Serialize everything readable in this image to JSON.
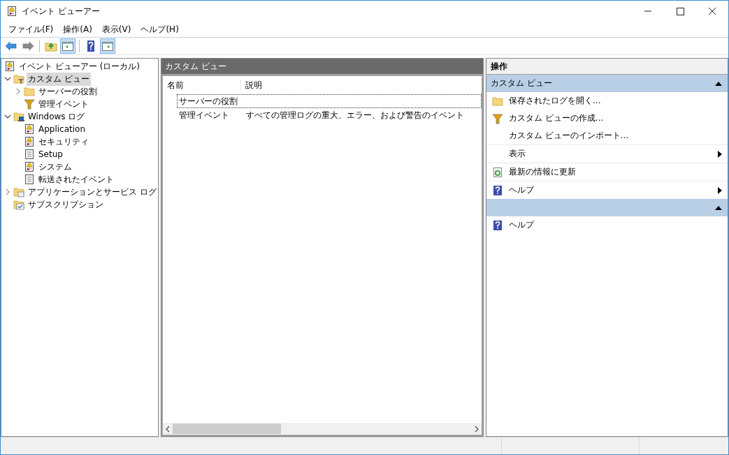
{
  "window": {
    "title": "イベント ビューアー"
  },
  "menu": [
    "ファイル(F)",
    "操作(A)",
    "表示(V)",
    "ヘルプ(H)"
  ],
  "toolbar": [
    [
      {
        "kind": "back",
        "on": false
      },
      {
        "kind": "forward",
        "on": false
      }
    ],
    [
      {
        "kind": "up",
        "on": false
      },
      {
        "kind": "tree",
        "on": true
      }
    ],
    [
      {
        "kind": "help",
        "on": false
      },
      {
        "kind": "pane",
        "on": true
      }
    ]
  ],
  "tree": {
    "items": [
      {
        "label": "イベント ビューアー (ローカル)",
        "kind": "viewer",
        "selected": false,
        "children": [
          {
            "label": "カスタム ビュー",
            "kind": "filterfolder",
            "selected": true,
            "expanded": true,
            "children": [
              {
                "label": "サーバーの役割",
                "kind": "folder",
                "selected": false,
                "expanded": false
              },
              {
                "label": "管理イベント",
                "kind": "filter",
                "selected": false
              }
            ]
          },
          {
            "label": "Windows ログ",
            "kind": "winfolder",
            "selected": false,
            "expanded": true,
            "children": [
              {
                "label": "Application",
                "kind": "warnlog",
                "selected": false
              },
              {
                "label": "セキュリティ",
                "kind": "warnlog",
                "selected": false
              },
              {
                "label": "Setup",
                "kind": "log",
                "selected": false
              },
              {
                "label": "システム",
                "kind": "warnlog",
                "selected": false
              },
              {
                "label": "転送されたイベント",
                "kind": "log",
                "selected": false
              }
            ]
          },
          {
            "label": "アプリケーションとサービス ログ",
            "kind": "appfolder",
            "selected": false,
            "expanded": false
          },
          {
            "label": "サブスクリプション",
            "kind": "subs",
            "selected": false
          }
        ]
      }
    ]
  },
  "center": {
    "title": "カスタム ビュー",
    "columns": [
      "名前",
      "説明"
    ],
    "rows": [
      {
        "name": "サーバーの役割",
        "description": "",
        "focused": true
      },
      {
        "name": "管理イベント",
        "description": "すべての管理ログの重大、エラー、および警告のイベント",
        "focused": false
      }
    ]
  },
  "actions": {
    "title": "操作",
    "sections": [
      {
        "title": "カスタム ビュー",
        "expanded": true,
        "items": [
          {
            "label": "保存されたログを開く...",
            "kind": "open",
            "submenu": false
          },
          {
            "label": "カスタム ビューの作成...",
            "kind": "filter",
            "submenu": false
          },
          {
            "label": "カスタム ビューのインポート...",
            "kind": "none",
            "submenu": false
          },
          {
            "label": "表示",
            "kind": "none",
            "submenu": true
          },
          {
            "label": "最新の情報に更新",
            "kind": "refresh",
            "submenu": false
          },
          {
            "label": "ヘルプ",
            "kind": "help",
            "submenu": true
          }
        ]
      },
      {
        "expanded": true,
        "items": [
          {
            "label": "ヘルプ",
            "kind": "help",
            "submenu": false
          }
        ]
      }
    ]
  }
}
